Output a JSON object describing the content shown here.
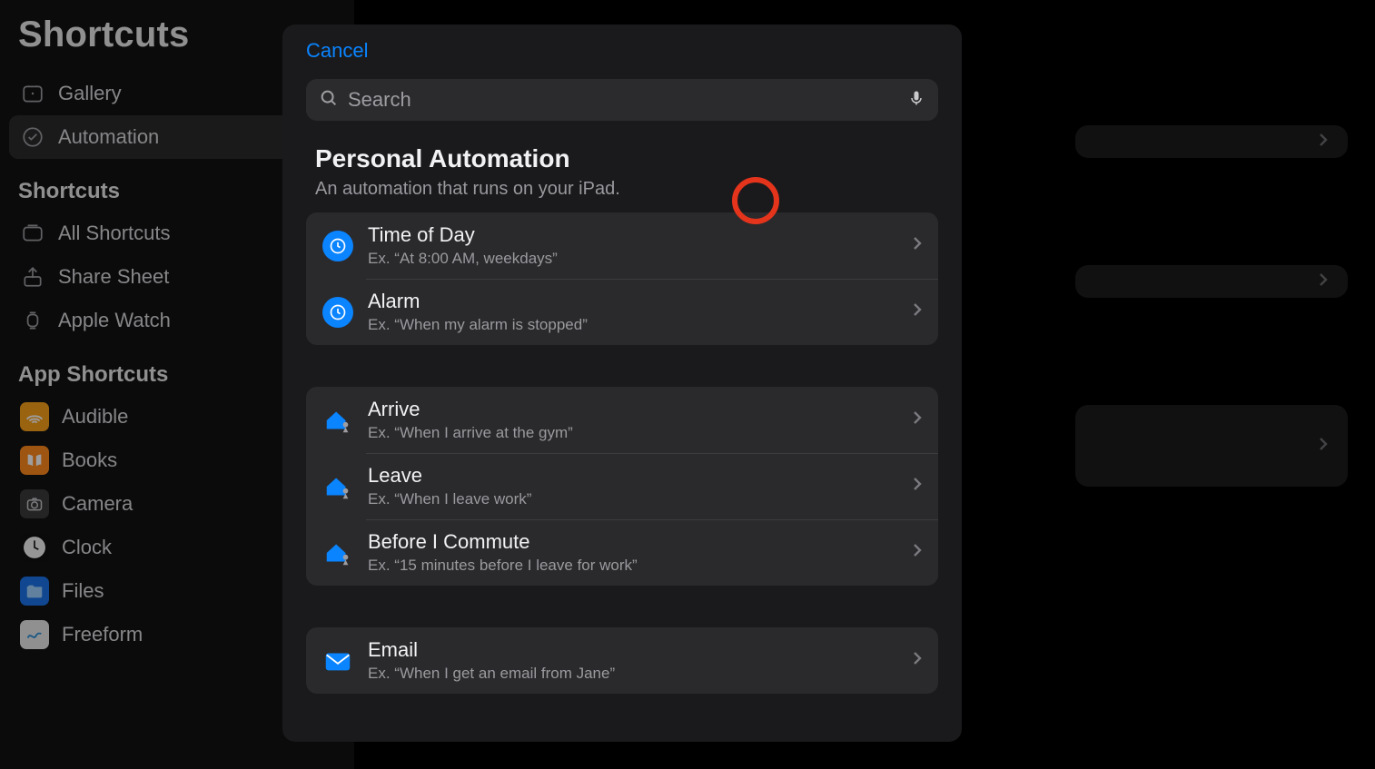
{
  "sidebar": {
    "title": "Shortcuts",
    "top_items": [
      {
        "label": "Gallery",
        "icon": "gallery"
      },
      {
        "label": "Automation",
        "icon": "clock-check"
      }
    ],
    "shortcuts_label": "Shortcuts",
    "shortcut_items": [
      {
        "label": "All Shortcuts",
        "icon": "grid"
      },
      {
        "label": "Share Sheet",
        "icon": "share"
      },
      {
        "label": "Apple Watch",
        "icon": "watch"
      }
    ],
    "apps_label": "App Shortcuts",
    "app_items": [
      {
        "label": "Audible",
        "icon": "audible"
      },
      {
        "label": "Books",
        "icon": "books"
      },
      {
        "label": "Camera",
        "icon": "camera"
      },
      {
        "label": "Clock",
        "icon": "clock"
      },
      {
        "label": "Files",
        "icon": "files"
      },
      {
        "label": "Freeform",
        "icon": "freeform"
      }
    ],
    "active_index": 1
  },
  "modal": {
    "cancel": "Cancel",
    "search_placeholder": "Search",
    "section_title": "Personal Automation",
    "section_subtitle": "An automation that runs on your iPad.",
    "groups": [
      {
        "rows": [
          {
            "title": "Time of Day",
            "subtitle": "Ex. “At 8:00 AM, weekdays”",
            "icon": "clock"
          },
          {
            "title": "Alarm",
            "subtitle": "Ex. “When my alarm is stopped”",
            "icon": "clock"
          }
        ]
      },
      {
        "rows": [
          {
            "title": "Arrive",
            "subtitle": "Ex. “When I arrive at the gym”",
            "icon": "house-person"
          },
          {
            "title": "Leave",
            "subtitle": "Ex. “When I leave work”",
            "icon": "house-person"
          },
          {
            "title": "Before I Commute",
            "subtitle": "Ex. “15 minutes before I leave for work”",
            "icon": "house-person"
          }
        ]
      },
      {
        "rows": [
          {
            "title": "Email",
            "subtitle": "Ex. “When I get an email from Jane”",
            "icon": "envelope"
          }
        ]
      }
    ]
  }
}
